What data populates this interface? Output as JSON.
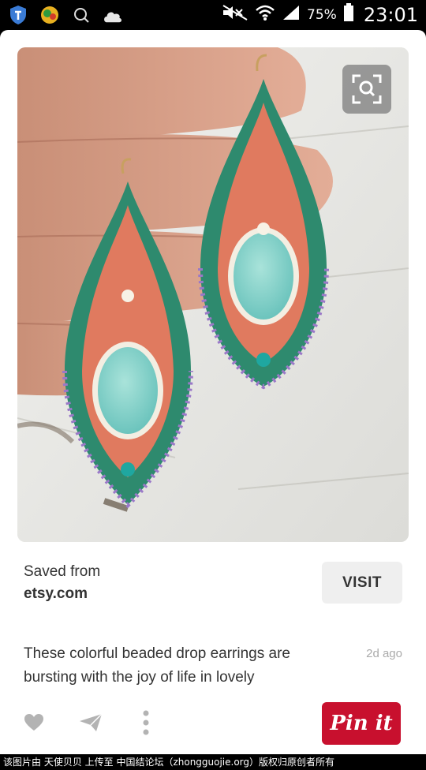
{
  "status_bar": {
    "battery_percent": "75%",
    "time": "23:01",
    "left_icons": [
      "shield-icon",
      "weather-icon",
      "search-icon",
      "cloud-app-icon"
    ],
    "right_icons": [
      "mute-icon",
      "wifi-icon",
      "signal-icon",
      "battery-icon"
    ]
  },
  "pin": {
    "image_icon": "visual-search-icon",
    "saved_from_label": "Saved from",
    "domain": "etsy.com",
    "visit_label": "VISIT",
    "description": "These colorful beaded drop earrings are bursting with the joy of life in lovely",
    "age": "2d ago",
    "pinit_label": "Pin it"
  },
  "actions": {
    "icons": [
      "heart-icon",
      "send-icon",
      "more-vertical-icon"
    ]
  },
  "watermark": "该图片由 天使贝贝 上传至 中国结论坛（zhongguojie.org）版权归原创者所有",
  "colors": {
    "pinit_red": "#c8102e",
    "visit_bg": "#efefef",
    "text": "#333333",
    "muted": "#aaaaaa"
  }
}
